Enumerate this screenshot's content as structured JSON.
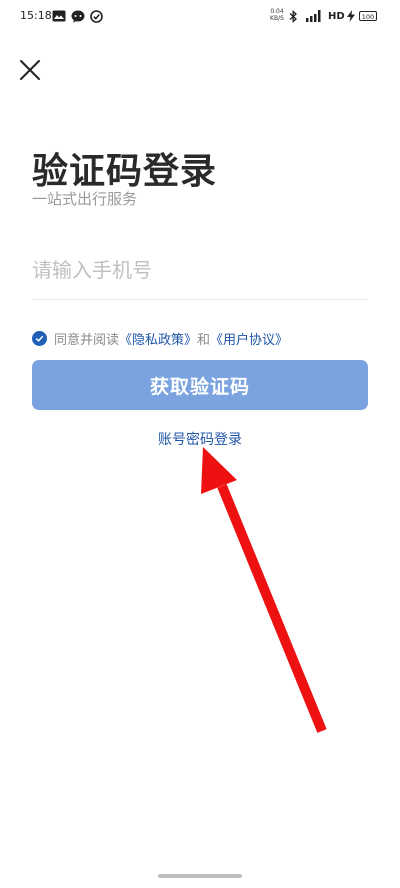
{
  "status_bar": {
    "time": "15:18",
    "net_speed_value": "0.04",
    "net_speed_unit": "KB/S",
    "network_type": "HD",
    "battery": "100"
  },
  "header": {
    "title": "验证码登录",
    "subtitle": "一站式出行服务"
  },
  "form": {
    "phone_placeholder": "请输入手机号",
    "phone_value": ""
  },
  "agreement": {
    "prefix": "同意并阅读",
    "privacy_link": "《隐私政策》",
    "connector": "和",
    "terms_link": "《用户协议》",
    "checked": true
  },
  "actions": {
    "get_code_label": "获取验证码",
    "password_login_label": "账号密码登录"
  },
  "colors": {
    "accent": "#1f56a8",
    "button_disabled": "#7aa3e0",
    "annotation_arrow": "#ee1111"
  }
}
